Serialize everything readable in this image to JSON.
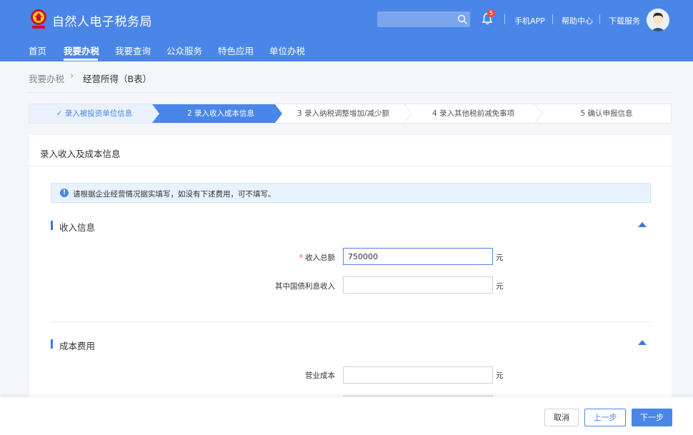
{
  "header": {
    "site_title": "自然人电子税务局",
    "notification_count": "5",
    "links": [
      "手机APP",
      "帮助中心",
      "下载服务"
    ]
  },
  "nav": {
    "items": [
      "首页",
      "我要办税",
      "我要查询",
      "公众服务",
      "特色应用",
      "单位办税"
    ],
    "active": "我要办税"
  },
  "breadcrumb": {
    "parent": "我要办税",
    "current": "经营所得（B表）"
  },
  "steps": [
    {
      "label": "✓ 录入被投资单位信息",
      "state": "done"
    },
    {
      "label": "2 录入收入成本信息",
      "state": "active"
    },
    {
      "label": "3 录入纳税调整增加/减少额",
      "state": "todo"
    },
    {
      "label": "4 录入其他税前减免事项",
      "state": "todo"
    },
    {
      "label": "5 确认申报信息",
      "state": "todo"
    }
  ],
  "card": {
    "title": "录入收入及成本信息",
    "notice": "请根据企业经营情况据实填写，如没有下述费用，可不填写。"
  },
  "income_section": {
    "title": "收入信息",
    "fields": [
      {
        "label": "收入总额",
        "required": true,
        "value": "750000",
        "unit": "元"
      },
      {
        "label": "其中国债利息收入",
        "required": false,
        "value": "",
        "unit": "元"
      }
    ]
  },
  "cost_section": {
    "title": "成本费用",
    "fields": [
      {
        "label": "营业成本",
        "required": false,
        "value": "",
        "unit": "元"
      }
    ]
  },
  "footer": {
    "cancel": "取消",
    "prev": "上一步",
    "next": "下一步"
  },
  "colors": {
    "primary": "#4a86e8",
    "required": "#f04a3e"
  }
}
